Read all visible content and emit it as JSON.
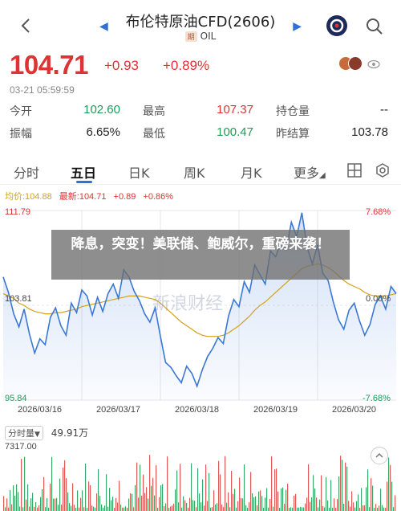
{
  "header": {
    "title": "布伦特原油CFD(2606)",
    "tag": "期",
    "subtitle": "OIL"
  },
  "quote": {
    "price": "104.71",
    "change": "+0.93",
    "change_pct": "+0.89%",
    "timestamp": "03-21 05:59:59",
    "views_icon": "eye-icon"
  },
  "stats": {
    "open_label": "今开",
    "open": "102.60",
    "high_label": "最高",
    "high": "107.37",
    "oi_label": "持仓量",
    "oi": "--",
    "amp_label": "振幅",
    "amp": "6.65%",
    "low_label": "最低",
    "low": "100.47",
    "prev_label": "昨结算",
    "prev": "103.78"
  },
  "tabs": [
    "分时",
    "五日",
    "日K",
    "周K",
    "月K",
    "更多"
  ],
  "active_tab": "五日",
  "legend": {
    "ma": "均价:104.88",
    "latest": "最新:104.71",
    "chg": "+0.89",
    "pct": "+0.86%"
  },
  "chart_data": {
    "type": "line",
    "y_max_label": "111.79",
    "y_min_label": "95.84",
    "y_mid_label": "103.81",
    "pct_max_label": "7.68%",
    "pct_mid_label": "0.00%",
    "pct_min_label": "-7.68%",
    "ylim": [
      95.84,
      111.79
    ],
    "dates": [
      "2026/03/16",
      "2026/03/17",
      "2026/03/18",
      "2026/03/19",
      "2026/03/20"
    ],
    "series": [
      {
        "values": [
          106.2,
          104.9,
          103.1,
          102.0,
          103.5,
          101.4,
          99.8,
          101.0,
          100.5,
          102.8,
          103.6,
          102.1,
          101.3,
          104.0,
          103.2,
          105.1,
          104.6,
          103.0,
          104.5,
          103.3,
          104.8,
          105.6,
          104.4,
          106.8,
          106.2,
          105.0,
          104.2,
          103.1,
          102.4,
          103.6,
          101.2,
          99.0,
          98.6,
          97.9,
          97.3,
          98.7,
          98.1,
          97.0,
          98.4,
          99.5,
          100.2,
          101.1,
          100.6,
          102.9,
          104.3,
          103.7,
          105.8,
          104.9,
          107.2,
          106.4,
          105.6,
          108.4,
          107.9,
          109.1,
          108.5,
          110.8,
          109.6,
          111.6,
          108.7,
          107.3,
          108.9,
          106.5,
          105.9,
          104.1,
          102.6,
          101.8,
          103.4,
          104.0,
          102.5,
          101.3,
          102.2,
          103.9,
          104.6,
          103.5,
          105.4,
          104.8
        ]
      },
      {
        "values": [
          104.8,
          104.6,
          104.4,
          104.0,
          103.8,
          103.5,
          103.3,
          103.2,
          103.1,
          103.1,
          103.2,
          103.2,
          103.3,
          103.4,
          103.5,
          103.7,
          103.8,
          103.9,
          104.0,
          104.1,
          104.2,
          104.3,
          104.4,
          104.5,
          104.6,
          104.6,
          104.6,
          104.5,
          104.4,
          104.3,
          104.0,
          103.6,
          103.2,
          102.8,
          102.4,
          102.1,
          101.8,
          101.5,
          101.3,
          101.2,
          101.2,
          101.2,
          101.3,
          101.5,
          101.8,
          102.1,
          102.5,
          102.9,
          103.4,
          103.8,
          104.1,
          104.5,
          104.9,
          105.3,
          105.7,
          106.1,
          106.5,
          106.9,
          107.1,
          107.2,
          107.3,
          107.2,
          107.0,
          106.7,
          106.3,
          105.9,
          105.6,
          105.4,
          105.2,
          104.9,
          104.7,
          104.6,
          104.6,
          104.6,
          104.7,
          104.8
        ]
      }
    ]
  },
  "overlay": {
    "headline": "降息，突变！美联储、鲍威尔，重磅来袭！"
  },
  "watermark": "新浪财经",
  "volume": {
    "tag": "分时量",
    "total": "49.91万",
    "max_label": "7317.00"
  },
  "colors": {
    "up": "#e03232",
    "down": "#1f9b57",
    "price_line": "#3a78d6",
    "avg_line": "#d4a11c"
  }
}
